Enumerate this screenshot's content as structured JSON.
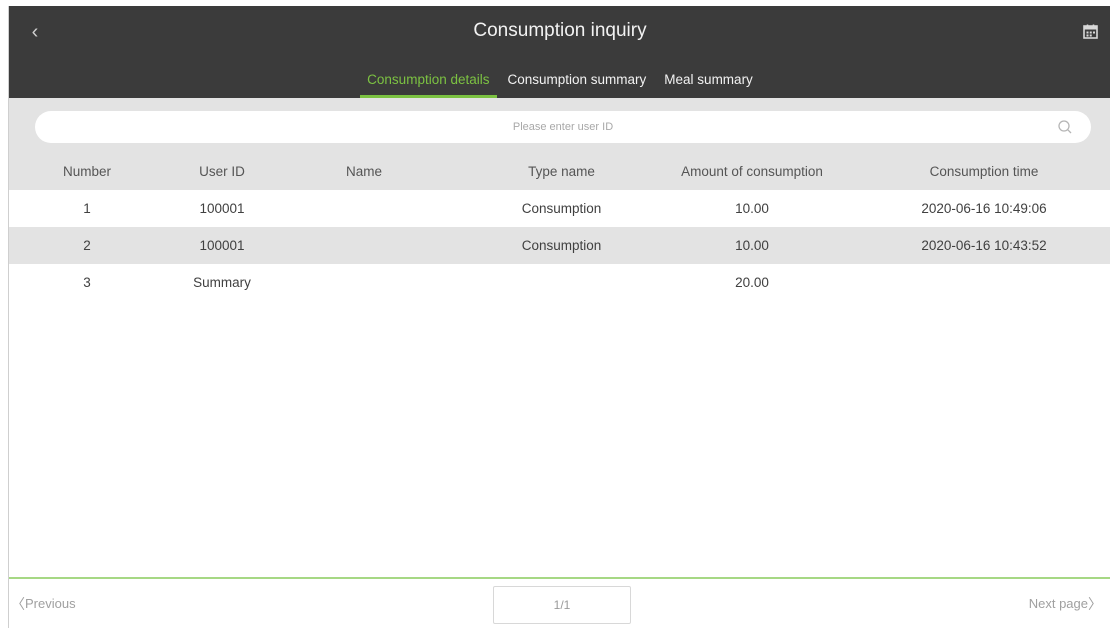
{
  "header": {
    "title": "Consumption inquiry",
    "back_icon": "chevron-left-icon",
    "calendar_icon": "calendar-icon"
  },
  "tabs": [
    {
      "label": "Consumption details",
      "active": true
    },
    {
      "label": "Consumption summary",
      "active": false
    },
    {
      "label": "Meal summary",
      "active": false
    }
  ],
  "search": {
    "placeholder": "Please enter user ID",
    "value": "",
    "icon": "search-icon"
  },
  "table": {
    "columns": [
      "Number",
      "User ID",
      "Name",
      "Type name",
      "Amount of consumption",
      "Consumption time"
    ],
    "rows": [
      {
        "number": "1",
        "user_id": "100001",
        "name": "",
        "type_name": "Consumption",
        "amount": "10.00",
        "time": "2020-06-16 10:49:06"
      },
      {
        "number": "2",
        "user_id": "100001",
        "name": "",
        "type_name": "Consumption",
        "amount": "10.00",
        "time": "2020-06-16 10:43:52"
      },
      {
        "number": "3",
        "user_id": "Summary",
        "name": "",
        "type_name": "",
        "amount": "20.00",
        "time": ""
      }
    ]
  },
  "pagination": {
    "previous_label": "Previous",
    "next_label": "Next page",
    "page_indicator": "1/1"
  },
  "colors": {
    "header_bg": "#3b3b3b",
    "accent": "#7cc242",
    "stripe": "#e3e3e3"
  }
}
